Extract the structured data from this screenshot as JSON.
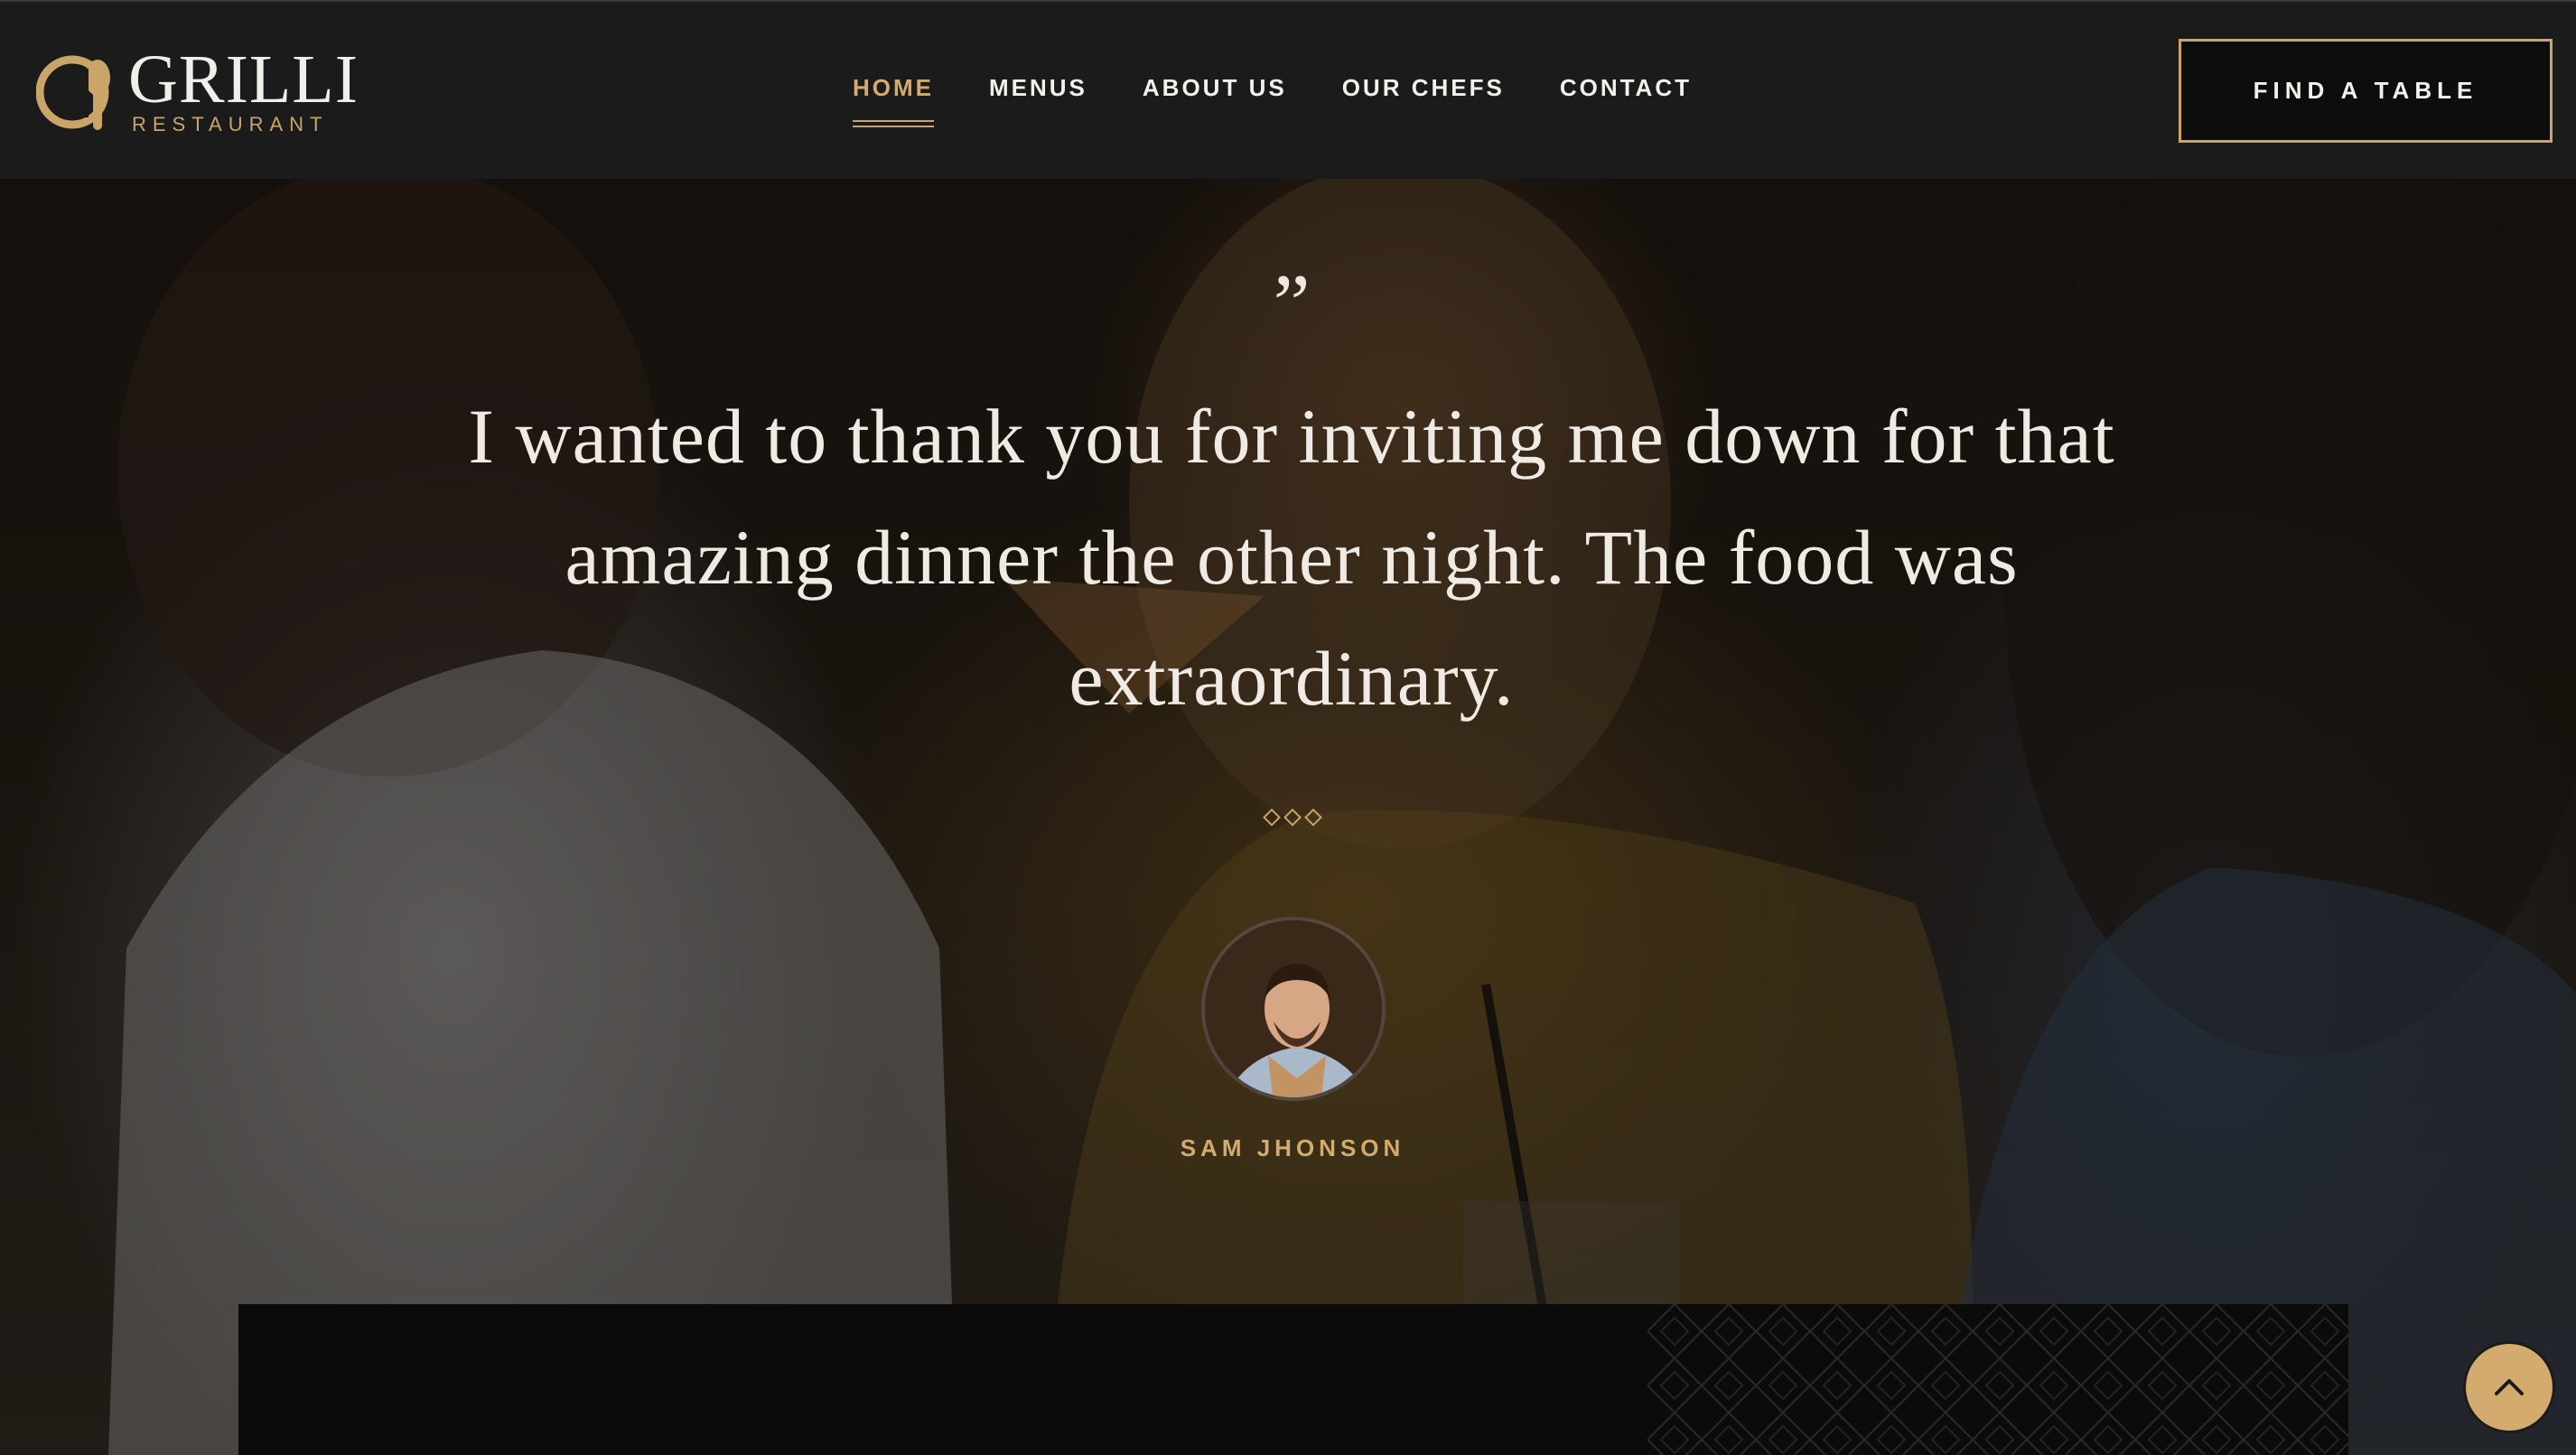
{
  "brand": {
    "name": "GRILLI",
    "tagline": "RESTAURANT",
    "accent_color": "#c9a56a",
    "logo_icon": "spoon-plate-logo-icon"
  },
  "nav": {
    "items": [
      {
        "label": "HOME",
        "active": true
      },
      {
        "label": "MENUS",
        "active": false
      },
      {
        "label": "ABOUT US",
        "active": false
      },
      {
        "label": "OUR CHEFS",
        "active": false
      },
      {
        "label": "CONTACT",
        "active": false
      }
    ]
  },
  "header": {
    "cta_label": "FIND A TABLE"
  },
  "testimonial": {
    "quote_mark": "”",
    "text": "I wanted to thank you for inviting me down for that amazing dinner the other night. The food was extraordinary.",
    "ornament_icon": "diamond-ornament-icon",
    "author": "SAM JHONSON",
    "avatar_icon": "person-avatar"
  },
  "back_to_top": {
    "icon": "chevron-up-icon"
  }
}
